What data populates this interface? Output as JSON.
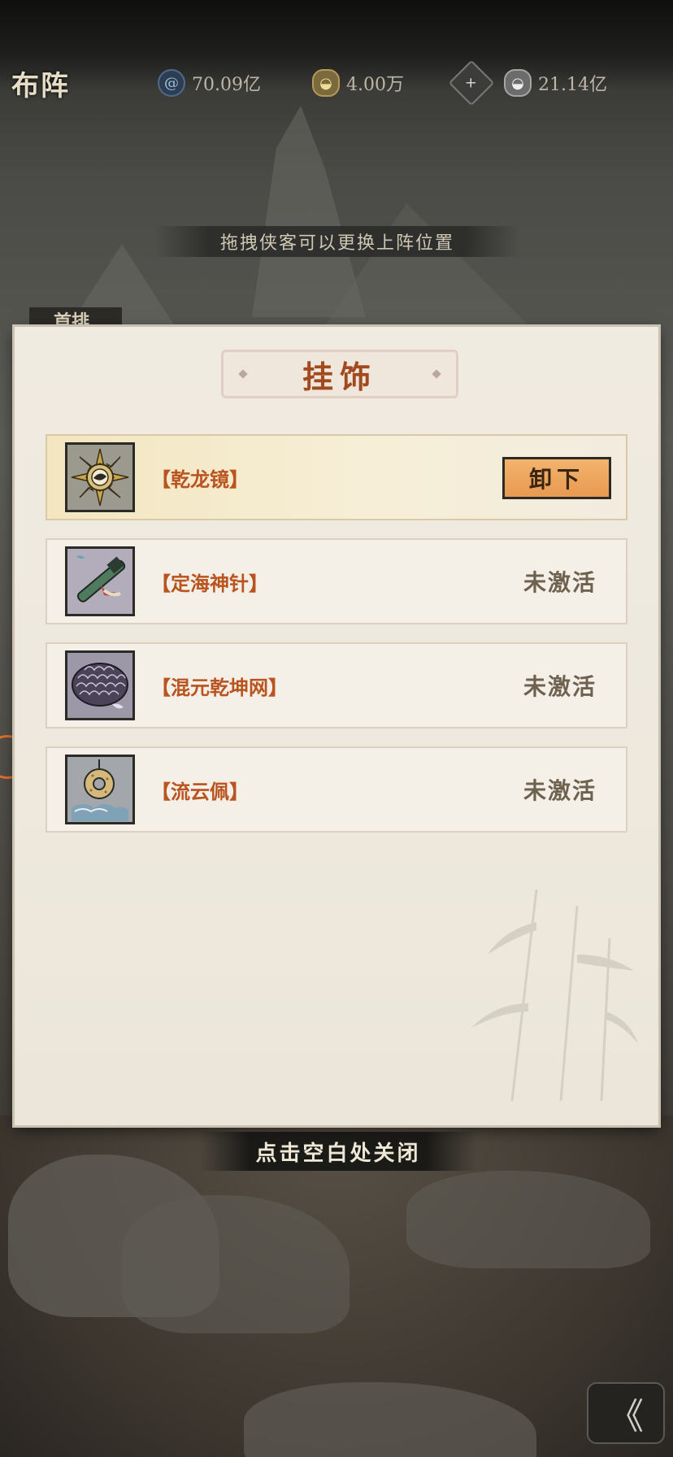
{
  "hud": {
    "title": "布阵",
    "resources": [
      {
        "icon": "swirl-icon",
        "value": "70.09亿"
      },
      {
        "icon": "gold-ingot-icon",
        "value": "4.00万"
      },
      {
        "icon": "plus-icon",
        "value": ""
      },
      {
        "icon": "silver-ingot-icon",
        "value": "21.14亿"
      }
    ]
  },
  "hint": "拖拽侠客可以更换上阵位置",
  "side_tab": "首排",
  "panel": {
    "title": "挂饰",
    "items": [
      {
        "name": "【乾龙镜】",
        "icon": "dragon-mirror-icon",
        "status": "",
        "action": "卸下",
        "active": true
      },
      {
        "name": "【定海神针】",
        "icon": "sea-needle-icon",
        "status": "未激活",
        "action": "",
        "active": false
      },
      {
        "name": "【混元乾坤网】",
        "icon": "cosmic-net-icon",
        "status": "未激活",
        "action": "",
        "active": false
      },
      {
        "name": "【流云佩】",
        "icon": "cloud-pendant-icon",
        "status": "未激活",
        "action": "",
        "active": false
      }
    ]
  },
  "close_hint": "点击空白处关闭",
  "colors": {
    "accent_orange": "#e89a50",
    "item_name": "#b9531f",
    "title_red": "#a24a1f",
    "panel_bg": "#f0ebe1"
  }
}
